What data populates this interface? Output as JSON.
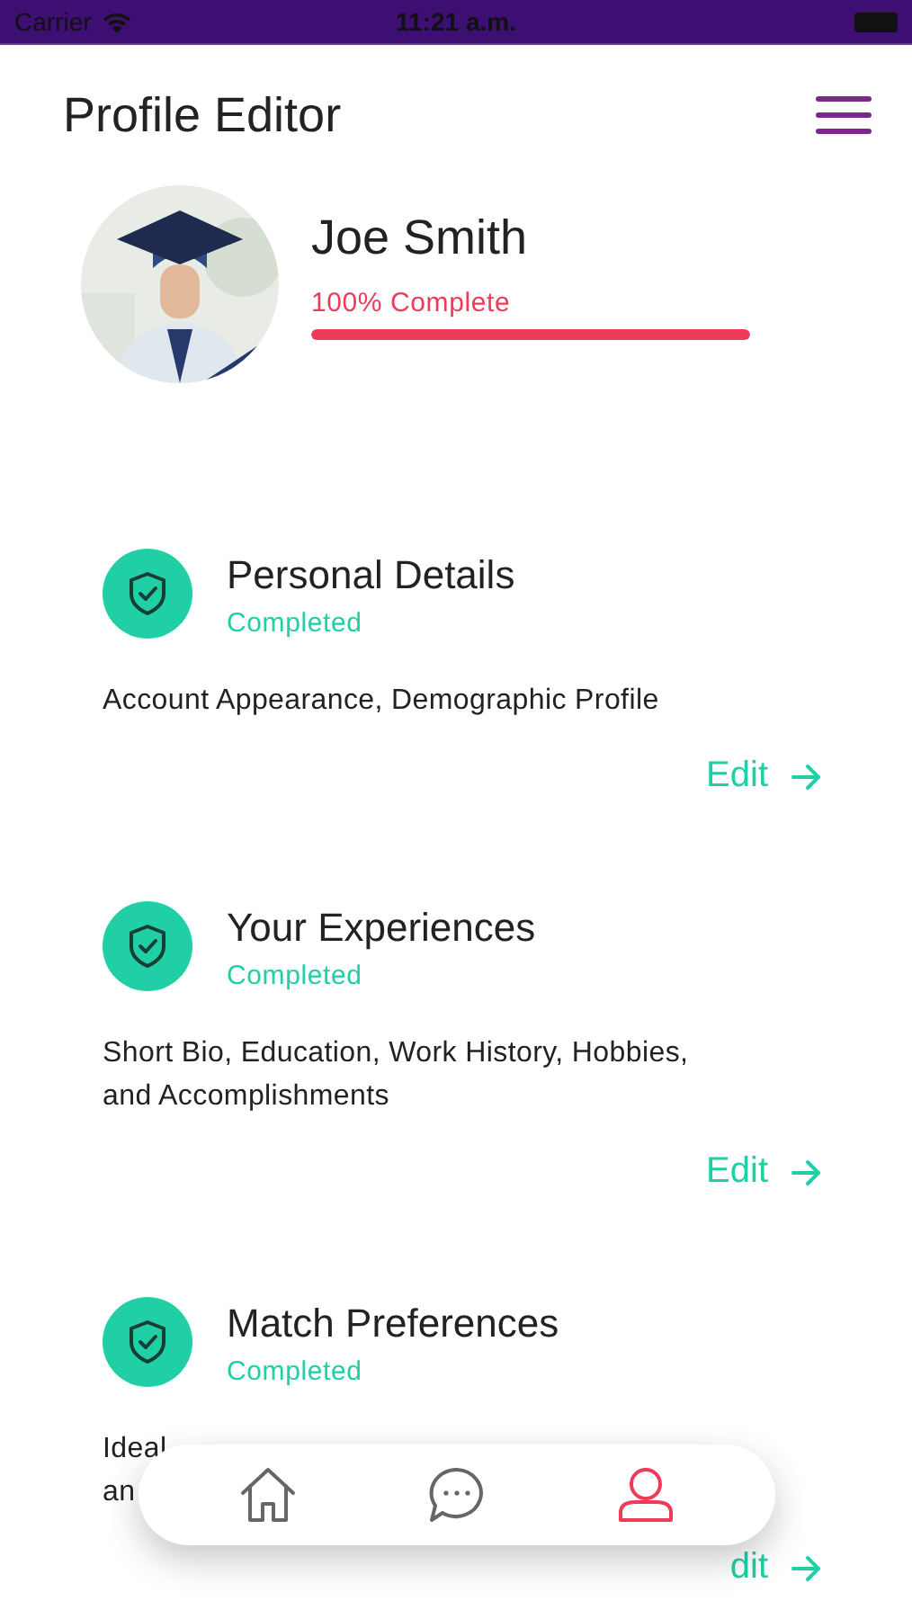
{
  "status_bar": {
    "carrier": "Carrier",
    "time": "11:21 a.m."
  },
  "header": {
    "title": "Profile Editor"
  },
  "profile": {
    "name": "Joe Smith",
    "progress_label": "100% Complete",
    "level": 1.0
  },
  "sections": [
    {
      "title": "Personal Details",
      "status": "Completed",
      "description": "Account Appearance, Demographic Profile",
      "action": "Edit"
    },
    {
      "title": "Your Experiences",
      "status": "Completed",
      "description": "Short Bio, Education, Work History, Hobbies, and Accomplishments",
      "action": "Edit"
    },
    {
      "title": "Match Preferences",
      "status": "Completed",
      "description": "Ideal",
      "description_line_2": "an",
      "action": "dit"
    }
  ],
  "bottom_nav": [
    {
      "kind": "home",
      "selected": false
    },
    {
      "kind": "chat",
      "selected": false
    },
    {
      "kind": "profile",
      "selected": true
    }
  ]
}
